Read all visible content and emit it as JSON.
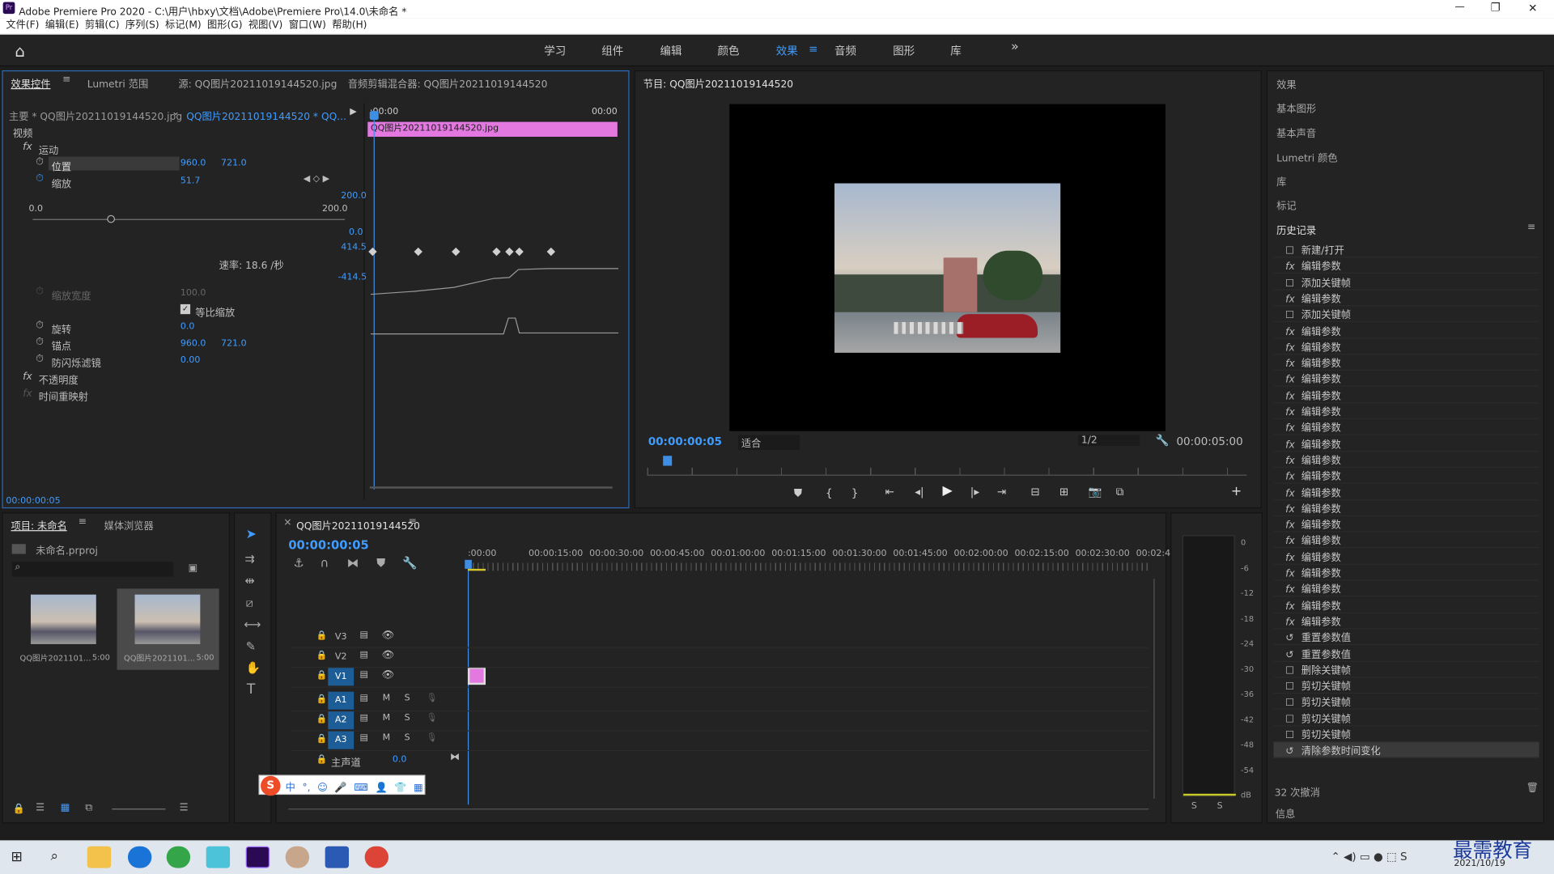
{
  "window": {
    "title": "Adobe Premiere Pro 2020 - C:\\用户\\hbxy\\文档\\Adobe\\Premiere Pro\\14.0\\未命名 *",
    "min": "—",
    "max": "❐",
    "close": "✕"
  },
  "menu": [
    "文件(F)",
    "编辑(E)",
    "剪辑(C)",
    "序列(S)",
    "标记(M)",
    "图形(G)",
    "视图(V)",
    "窗口(W)",
    "帮助(H)"
  ],
  "workspaces": [
    "学习",
    "组件",
    "编辑",
    "颜色",
    "效果",
    "音频",
    "图形",
    "库"
  ],
  "workspace_more": "»",
  "effect_controls": {
    "tabs": [
      "效果控件",
      "Lumetri 范围",
      "源: QQ图片20211019144520.jpg",
      "音频剪辑混合器: QQ图片20211019144520"
    ],
    "master": "主要 * QQ图片20211019144520.jpg",
    "clip": "QQ图片20211019144520 * QQ...",
    "t_start": ":00:00",
    "t_end": "00:00",
    "clip_bar": "QQ图片20211019144520.jpg",
    "video_label": "视频",
    "motion": "运动",
    "position": "位置",
    "pos_x": "960.0",
    "pos_y": "721.0",
    "scale": "缩放",
    "scale_val": "51.7",
    "range_min": "0.0",
    "range_max": "200.0",
    "g_top": "200.0",
    "g_mid": "0.0",
    "g_hi": "414.5",
    "g_lo": "-414.5",
    "rate": "速率: 18.6 /秒",
    "scale_width": "缩放宽度",
    "scale_width_val": "100.0",
    "uniform": "等比缩放",
    "rotation": "旋转",
    "rotation_val": "0.0",
    "anchor": "锚点",
    "anchor_x": "960.0",
    "anchor_y": "721.0",
    "flicker": "防闪烁滤镜",
    "flicker_val": "0.00",
    "opacity": "不透明度",
    "remap": "时间重映射",
    "timecode": "00:00:00:05"
  },
  "program": {
    "title": "节目: QQ图片20211019144520",
    "timecode": "00:00:00:05",
    "fit": "适合",
    "res": "1/2",
    "duration": "00:00:05:00"
  },
  "right": {
    "items": [
      "效果",
      "基本图形",
      "基本声音",
      "Lumetri 颜色",
      "库",
      "标记"
    ],
    "history_title": "历史记录",
    "history": [
      {
        "i": "☐",
        "t": "新建/打开"
      },
      {
        "i": "fx",
        "t": "编辑参数"
      },
      {
        "i": "☐",
        "t": "添加关键帧"
      },
      {
        "i": "fx",
        "t": "编辑参数"
      },
      {
        "i": "☐",
        "t": "添加关键帧"
      },
      {
        "i": "fx",
        "t": "编辑参数"
      },
      {
        "i": "fx",
        "t": "编辑参数"
      },
      {
        "i": "fx",
        "t": "编辑参数"
      },
      {
        "i": "fx",
        "t": "编辑参数"
      },
      {
        "i": "fx",
        "t": "编辑参数"
      },
      {
        "i": "fx",
        "t": "编辑参数"
      },
      {
        "i": "fx",
        "t": "编辑参数"
      },
      {
        "i": "fx",
        "t": "编辑参数"
      },
      {
        "i": "fx",
        "t": "编辑参数"
      },
      {
        "i": "fx",
        "t": "编辑参数"
      },
      {
        "i": "fx",
        "t": "编辑参数"
      },
      {
        "i": "fx",
        "t": "编辑参数"
      },
      {
        "i": "fx",
        "t": "编辑参数"
      },
      {
        "i": "fx",
        "t": "编辑参数"
      },
      {
        "i": "fx",
        "t": "编辑参数"
      },
      {
        "i": "fx",
        "t": "编辑参数"
      },
      {
        "i": "fx",
        "t": "编辑参数"
      },
      {
        "i": "fx",
        "t": "编辑参数"
      },
      {
        "i": "fx",
        "t": "编辑参数"
      },
      {
        "i": "↺",
        "t": "重置参数值"
      },
      {
        "i": "↺",
        "t": "重置参数值"
      },
      {
        "i": "☐",
        "t": "删除关键帧"
      },
      {
        "i": "☐",
        "t": "剪切关键帧"
      },
      {
        "i": "☐",
        "t": "剪切关键帧"
      },
      {
        "i": "☐",
        "t": "剪切关键帧"
      },
      {
        "i": "☐",
        "t": "剪切关键帧"
      },
      {
        "i": "↺",
        "t": "清除参数时间变化"
      }
    ],
    "undo": "32 次撤消",
    "info": "信息"
  },
  "project": {
    "tabs": [
      "项目: 未命名",
      "媒体浏览器"
    ],
    "file": "未命名.prproj",
    "items": [
      {
        "name": "QQ图片2021101...",
        "dur": "5:00"
      },
      {
        "name": "QQ图片2021101...",
        "dur": "5:00"
      }
    ]
  },
  "timeline": {
    "tab": "QQ图片20211019144520",
    "timecode": "00:00:00:05",
    "ruler": [
      ":00:00",
      "00:00:15:00",
      "00:00:30:00",
      "00:00:45:00",
      "00:01:00:00",
      "00:01:15:00",
      "00:01:30:00",
      "00:01:45:00",
      "00:02:00:00",
      "00:02:15:00",
      "00:02:30:00",
      "00:02:45:"
    ],
    "tracks": [
      "V3",
      "V2",
      "V1",
      "A1",
      "A2",
      "A3"
    ],
    "master": "主声道",
    "master_val": "0.0"
  },
  "meter": {
    "labels": [
      "0",
      "-6",
      "-12",
      "-18",
      "-24",
      "-30",
      "-36",
      "-42",
      "-48",
      "-54",
      "dB"
    ],
    "s1": "S",
    "s2": "S"
  },
  "ime": [
    "中",
    "°,",
    "☺",
    "🎤",
    "⌨",
    "👤",
    "👕",
    "▦"
  ],
  "taskbar": {
    "date": "2021/10/19",
    "watermark": "最需教育"
  }
}
